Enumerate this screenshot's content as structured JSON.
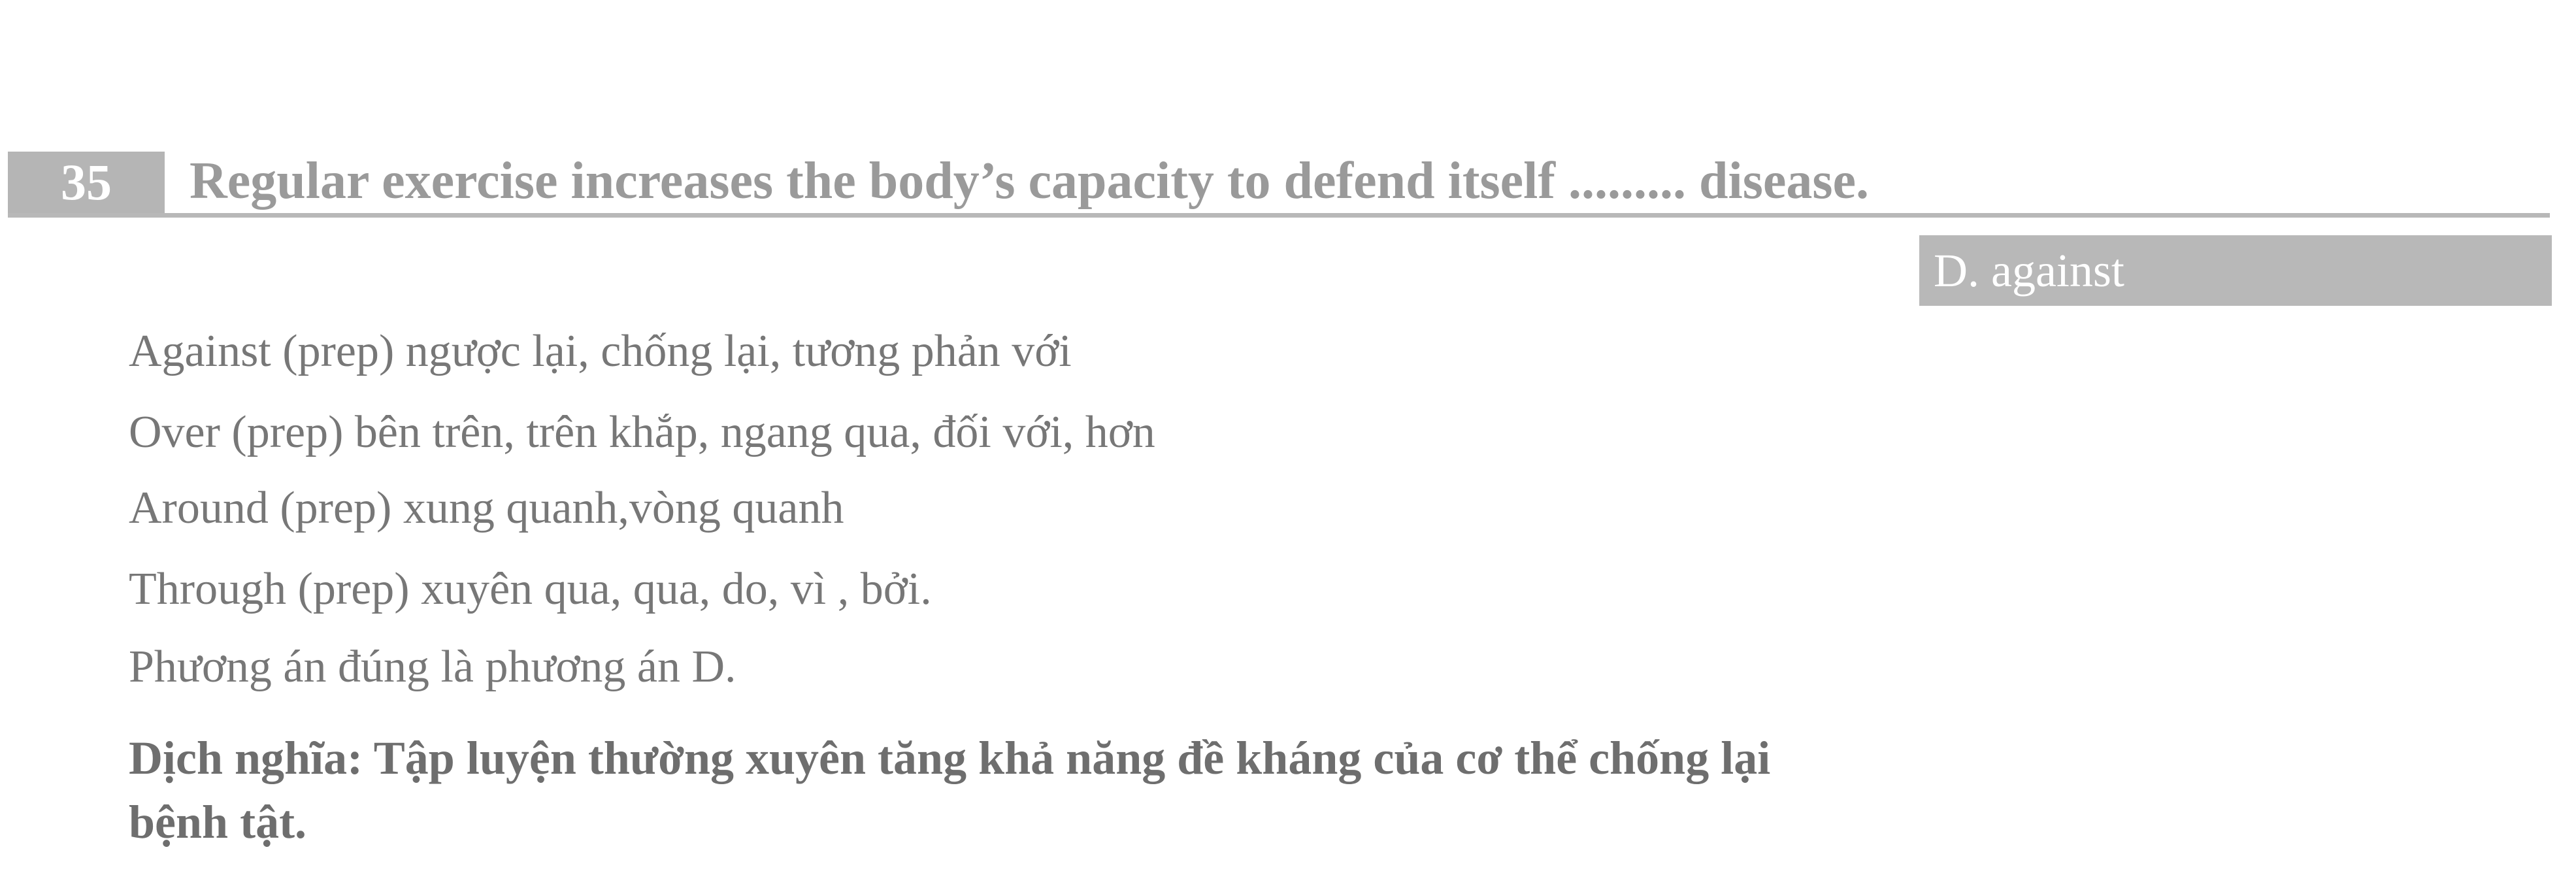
{
  "question": {
    "number": "35",
    "text": "Regular exercise increases the body’s capacity to defend itself ......... disease."
  },
  "answer": "D. against",
  "explanations": [
    "Against (prep) ngược lại, chống lại, tương phản với",
    "Over (prep) bên trên, trên khắp, ngang qua, đối với, hơn",
    "Around (prep) xung quanh,vòng quanh",
    "Through (prep) xuyên qua, qua, do, vì , bởi.",
    "Phương án đúng là phương án D."
  ],
  "translation": {
    "line1": "Dịch nghĩa: Tập luyện thường xuyên tăng khả năng đề kháng của cơ thể chống lại",
    "line2": "bệnh tật."
  }
}
